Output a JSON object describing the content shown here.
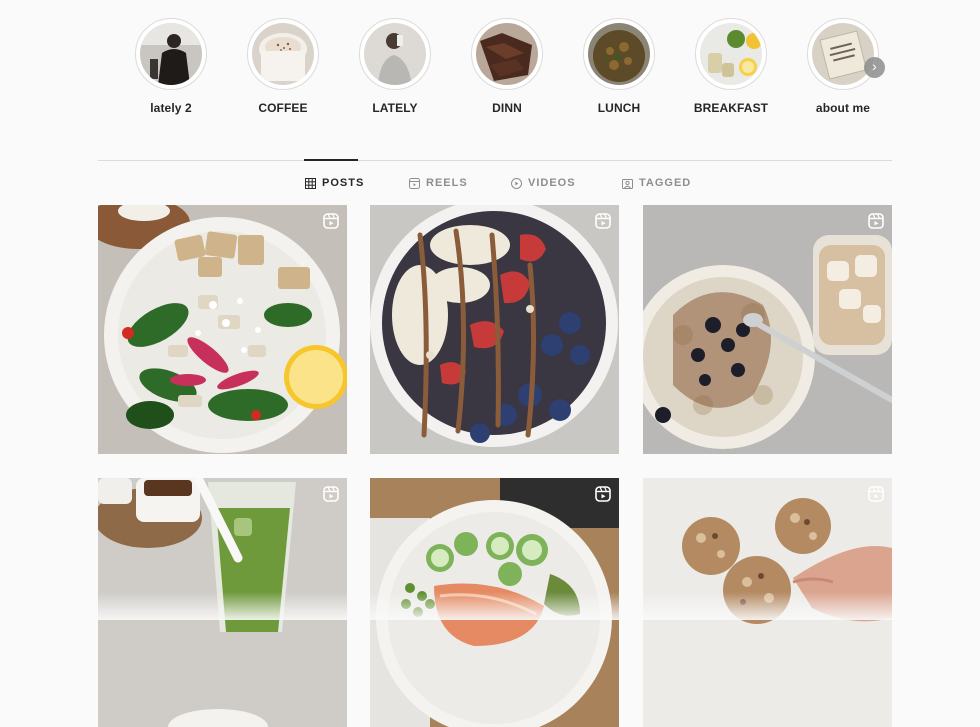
{
  "highlights": [
    {
      "label": "lately 2"
    },
    {
      "label": "COFFEE"
    },
    {
      "label": "LATELY"
    },
    {
      "label": "DINN"
    },
    {
      "label": "LUNCH"
    },
    {
      "label": "BREAKFAST"
    },
    {
      "label": "about me"
    }
  ],
  "highlights_next_icon": "chevron-right-icon",
  "tabs": [
    {
      "label": "POSTS",
      "icon": "grid-icon",
      "active": true
    },
    {
      "label": "REELS",
      "icon": "reels-icon",
      "active": false
    },
    {
      "label": "VIDEOS",
      "icon": "play-icon",
      "active": false
    },
    {
      "label": "TAGGED",
      "icon": "tagged-icon",
      "active": false
    }
  ],
  "posts": [
    {
      "subject": "salad",
      "badge": "reel-icon"
    },
    {
      "subject": "smoothie bowl",
      "badge": "reel-icon"
    },
    {
      "subject": "oatmeal",
      "badge": "reel-icon"
    },
    {
      "subject": "matcha",
      "badge": "reel-icon"
    },
    {
      "subject": "salmon bowl",
      "badge": "reel-icon"
    },
    {
      "subject": "energy balls",
      "badge": "reel-icon"
    }
  ],
  "colors": {
    "text": "#262626",
    "muted": "#8e8e8e",
    "divider": "#dbdbdb",
    "background": "#fafafa"
  }
}
